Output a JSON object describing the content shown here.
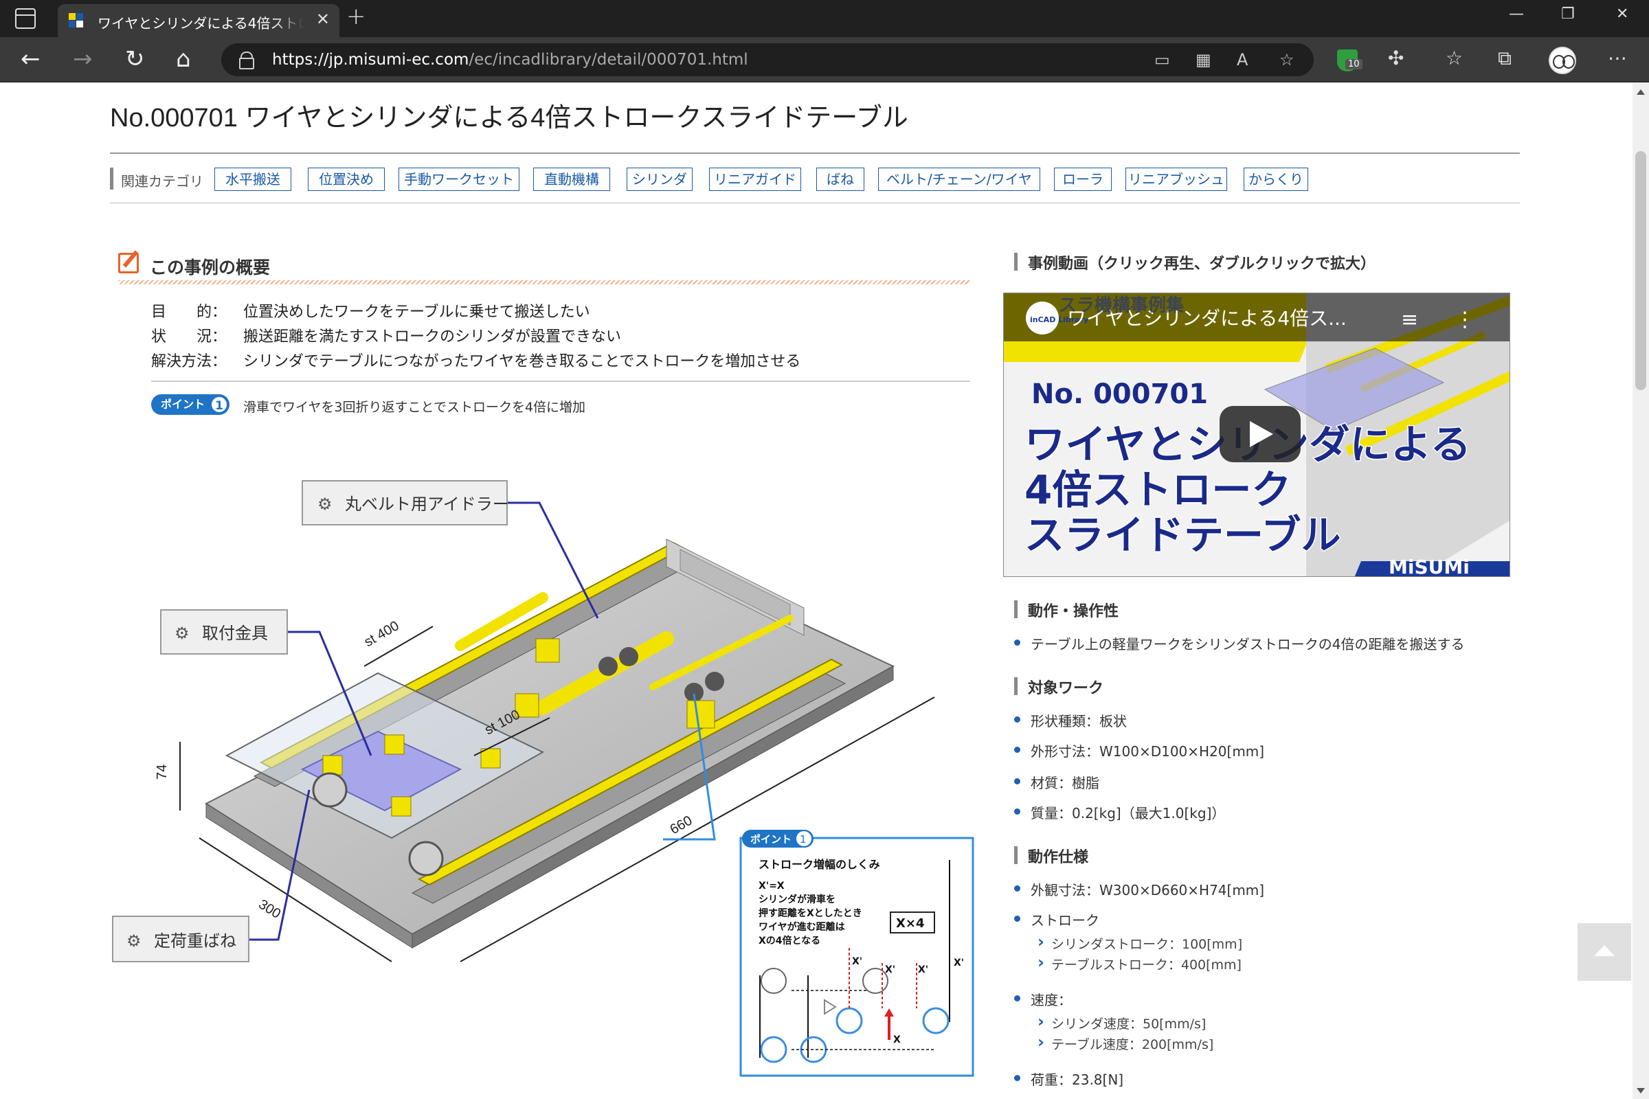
{
  "browser": {
    "tab_title": "ワイヤとシリンダによる4倍ストロークスライドテーブル",
    "url_host": "https://jp.misumi-ec.com",
    "url_path": "/ec/incadlibrary/detail/000701.html",
    "extension_badge": "10"
  },
  "page": {
    "title": "No.000701 ワイヤとシリンダによる4倍ストロークスライドテーブル",
    "category_label": "関連カテゴリ",
    "categories": [
      "水平搬送",
      "位置決め",
      "手動ワークセット",
      "直動機構",
      "シリンダ",
      "リニアガイド",
      "ばね",
      "ベルト/チェーン/ワイヤ",
      "ローラ",
      "リニアブッシュ",
      "からくり"
    ]
  },
  "summary": {
    "heading": "この事例の概要",
    "rows": [
      {
        "key": "目　　的：",
        "value": "位置決めしたワークをテーブルに乗せて搬送したい"
      },
      {
        "key": "状　　況：",
        "value": "搬送距離を満たすストロークのシリンダが設置できない"
      },
      {
        "key": "解決方法：",
        "value": "シリンダでテーブルにつながったワイヤを巻き取ることでストロークを増加させる"
      }
    ],
    "point_label": "ポイント",
    "point_number": "1",
    "point_text": "滑車でワイヤを3回折り返すことでストロークを4倍に増加"
  },
  "diagram": {
    "callouts": [
      "丸ベルト用アイドラー",
      "取付金具",
      "定荷重ばね"
    ],
    "dims": [
      "st 400",
      "st 100",
      "74",
      "660",
      "300"
    ],
    "inset": {
      "label": "ポイント",
      "number": "1",
      "title": "ストローク増幅のしくみ",
      "lines": [
        "X'=X",
        "シリンダが滑車を",
        "押す距離をXとしたとき",
        "ワイヤが進む距離は",
        "Xの4倍となる"
      ],
      "mult": "X×4",
      "xp": "X'",
      "x": "X"
    }
  },
  "video": {
    "heading": "事例動画（クリック再生、ダブルクリックで拡大）",
    "overlay_title": "ワイヤとシリンダによる4倍ス...",
    "banner": "スラ機構事例集",
    "logo_small": "inCAD Library",
    "number": "No. 000701",
    "line1": "ワイヤとシリンダによる",
    "line2": "4倍ストローク",
    "line3": "スライドテーブル",
    "brand": "MiSUMi"
  },
  "specs": {
    "ops_heading": "動作・操作性",
    "ops_items": [
      "テーブル上の軽量ワークをシリンダストロークの4倍の距離を搬送する"
    ],
    "work_heading": "対象ワーク",
    "work_items": [
      "形状種類：板状",
      "外形寸法：W100×D100×H20[mm]",
      "材質：樹脂",
      "質量：0.2[kg]（最大1.0[kg]）"
    ],
    "spec_heading": "動作仕様",
    "spec_items": [
      "外観寸法：W300×D660×H74[mm]",
      "ストローク",
      "速度：",
      "荷重：23.8[N]"
    ],
    "stroke_subs": [
      "シリンダストローク：100[mm]",
      "テーブルストローク：400[mm]"
    ],
    "speed_subs": [
      "シリンダ速度：50[mm/s]",
      "テーブル速度：200[mm/s]"
    ]
  },
  "colors": {
    "accent": "#1a5aa6",
    "orange": "#e8622b",
    "yellow": "#f2e200"
  }
}
